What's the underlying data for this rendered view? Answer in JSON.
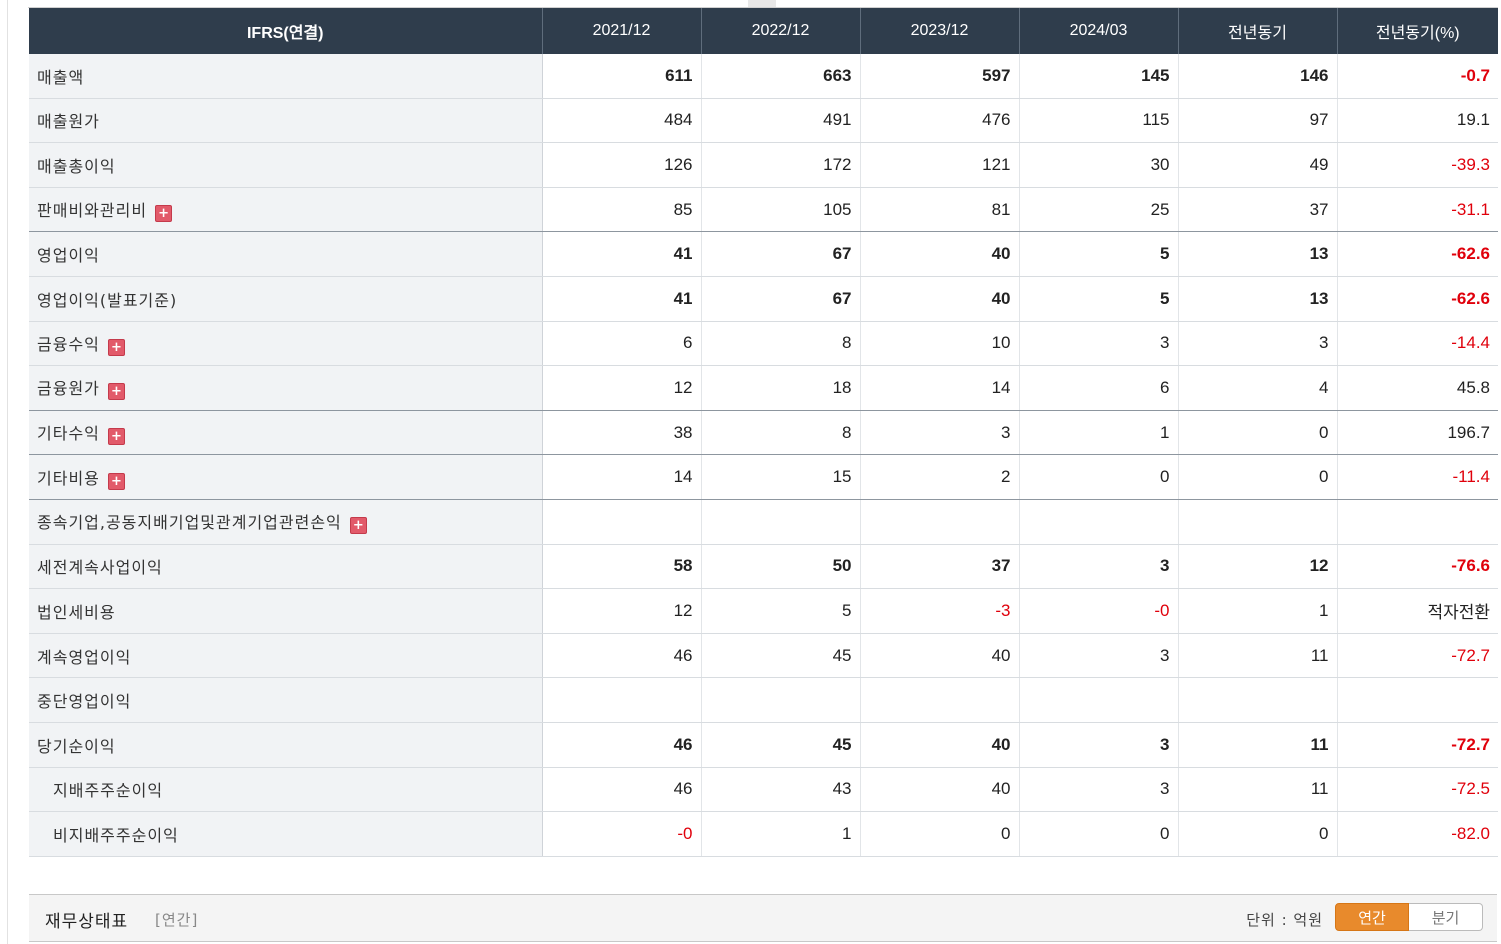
{
  "header": {
    "label": "IFRS(연결)",
    "cols": [
      "2021/12",
      "2022/12",
      "2023/12",
      "2024/03",
      "전년동기",
      "전년동기(%)"
    ]
  },
  "rows": [
    {
      "label": "매출액",
      "values": [
        "611",
        "663",
        "597",
        "145",
        "146",
        "-0.7"
      ]
    },
    {
      "label": "매출원가",
      "values": [
        "484",
        "491",
        "476",
        "115",
        "97",
        "19.1"
      ]
    },
    {
      "label": "매출총이익",
      "values": [
        "126",
        "172",
        "121",
        "30",
        "49",
        "-39.3"
      ]
    },
    {
      "label": "판매비와관리비",
      "values": [
        "85",
        "105",
        "81",
        "25",
        "37",
        "-31.1"
      ]
    },
    {
      "label": "영업이익",
      "values": [
        "41",
        "67",
        "40",
        "5",
        "13",
        "-62.6"
      ]
    },
    {
      "label": "영업이익(발표기준)",
      "values": [
        "41",
        "67",
        "40",
        "5",
        "13",
        "-62.6"
      ]
    },
    {
      "label": "금융수익",
      "values": [
        "6",
        "8",
        "10",
        "3",
        "3",
        "-14.4"
      ]
    },
    {
      "label": "금융원가",
      "values": [
        "12",
        "18",
        "14",
        "6",
        "4",
        "45.8"
      ]
    },
    {
      "label": "기타수익",
      "values": [
        "38",
        "8",
        "3",
        "1",
        "0",
        "196.7"
      ]
    },
    {
      "label": "기타비용",
      "values": [
        "14",
        "15",
        "2",
        "0",
        "0",
        "-11.4"
      ]
    },
    {
      "label": "종속기업,공동지배기업및관계기업관련손익",
      "values": [
        "",
        "",
        "",
        "",
        "",
        ""
      ]
    },
    {
      "label": "세전계속사업이익",
      "values": [
        "58",
        "50",
        "37",
        "3",
        "12",
        "-76.6"
      ]
    },
    {
      "label": "법인세비용",
      "values": [
        "12",
        "5",
        "-3",
        "-0",
        "1",
        "적자전환"
      ]
    },
    {
      "label": "계속영업이익",
      "values": [
        "46",
        "45",
        "40",
        "3",
        "11",
        "-72.7"
      ]
    },
    {
      "label": "중단영업이익",
      "values": [
        "",
        "",
        "",
        "",
        "",
        ""
      ]
    },
    {
      "label": "당기순이익",
      "values": [
        "46",
        "45",
        "40",
        "3",
        "11",
        "-72.7"
      ]
    },
    {
      "label": "지배주주순이익",
      "values": [
        "46",
        "43",
        "40",
        "3",
        "11",
        "-72.5"
      ]
    },
    {
      "label": "비지배주주순이익",
      "values": [
        "-0",
        "1",
        "0",
        "0",
        "0",
        "-82.0"
      ]
    }
  ],
  "plus_icon": "+",
  "balance_sheet": {
    "title": "재무상태표",
    "period": "[연간]",
    "unit": "단위 : 억원",
    "annual_label": "연간",
    "quarter_label": "분기"
  },
  "colors": {
    "header_bg": "#2f3d4c",
    "negative": "#e0000b",
    "active_toggle": "#e88a2c"
  }
}
